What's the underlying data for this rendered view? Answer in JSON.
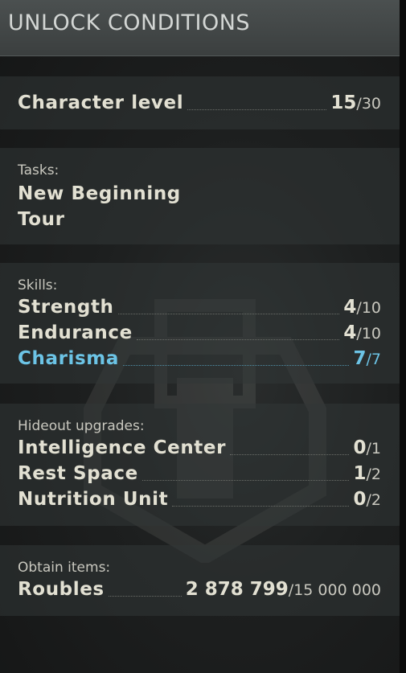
{
  "header": {
    "title": "UNLOCK CONDITIONS"
  },
  "character_level": {
    "label": "Character level",
    "current": "15",
    "max": "30"
  },
  "tasks": {
    "label": "Tasks:",
    "items": [
      "New Beginning",
      "Tour"
    ]
  },
  "skills": {
    "label": "Skills:",
    "items": [
      {
        "name": "Strength",
        "current": "4",
        "max": "10"
      },
      {
        "name": "Endurance",
        "current": "4",
        "max": "10"
      },
      {
        "name": "Charisma",
        "current": "7",
        "max": "7"
      }
    ]
  },
  "hideout": {
    "label": "Hideout upgrades:",
    "items": [
      {
        "name": "Intelligence Center",
        "current": "0",
        "max": "1"
      },
      {
        "name": "Rest Space",
        "current": "1",
        "max": "2"
      },
      {
        "name": "Nutrition Unit",
        "current": "0",
        "max": "2"
      }
    ]
  },
  "obtain": {
    "label": "Obtain items:",
    "items": [
      {
        "name": "Roubles",
        "current": "2 878 799",
        "max": "15 000 000"
      }
    ]
  },
  "separator": "/",
  "colors": {
    "text": "#e2e0d2",
    "met_condition": "#6cc4e6",
    "header_bg": "#444949",
    "section_bg": "#2e3232"
  }
}
